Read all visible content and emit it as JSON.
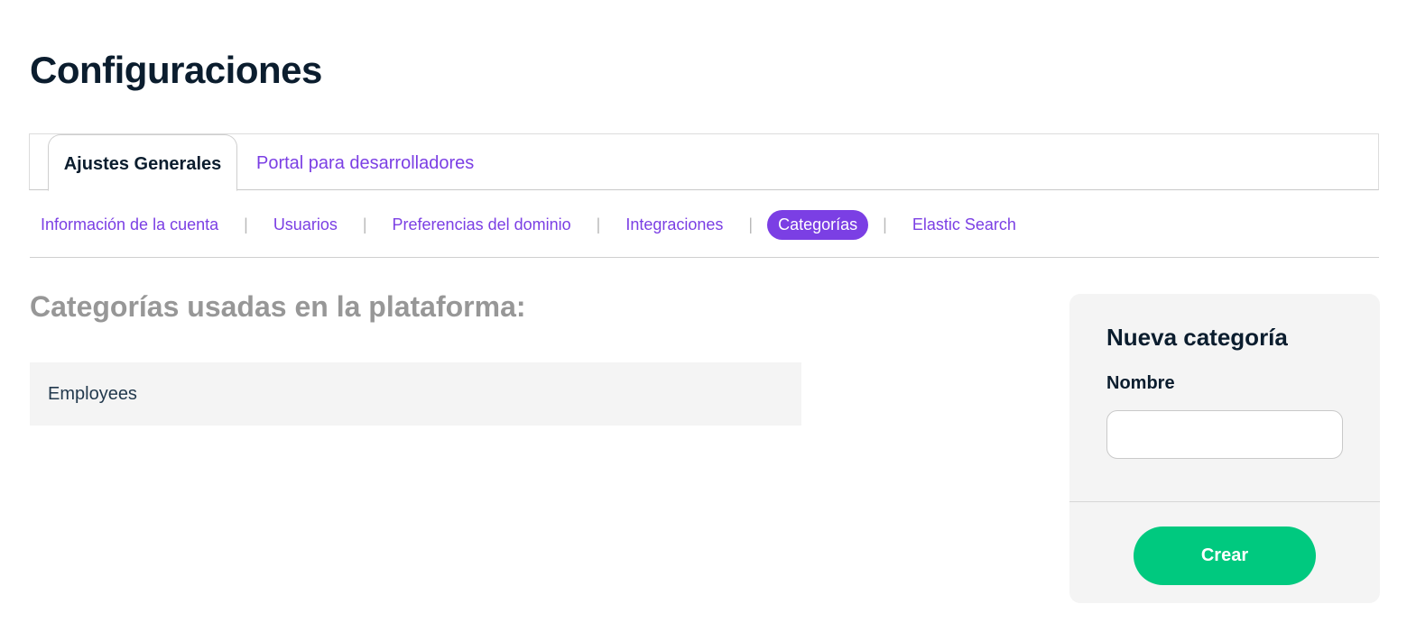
{
  "page": {
    "title": "Configuraciones"
  },
  "tabs": [
    {
      "label": "Ajustes Generales",
      "active": true
    },
    {
      "label": "Portal para desarrolladores",
      "active": false
    }
  ],
  "subnav": {
    "items": [
      {
        "label": "Información de la cuenta",
        "active": false
      },
      {
        "label": "Usuarios",
        "active": false
      },
      {
        "label": "Preferencias del dominio",
        "active": false
      },
      {
        "label": "Integraciones",
        "active": false
      },
      {
        "label": "Categorías",
        "active": true
      },
      {
        "label": "Elastic Search",
        "active": false
      }
    ],
    "separator": "|"
  },
  "categories": {
    "heading": "Categorías usadas en la plataforma:",
    "items": [
      "Employees"
    ]
  },
  "new_category": {
    "title": "Nueva categoría",
    "name_label": "Nombre",
    "name_value": "",
    "create_label": "Crear"
  },
  "colors": {
    "accent": "#7b3fe4",
    "primary_button": "#00c97f",
    "title_text": "#0b1d2e",
    "muted_heading": "#979797"
  }
}
